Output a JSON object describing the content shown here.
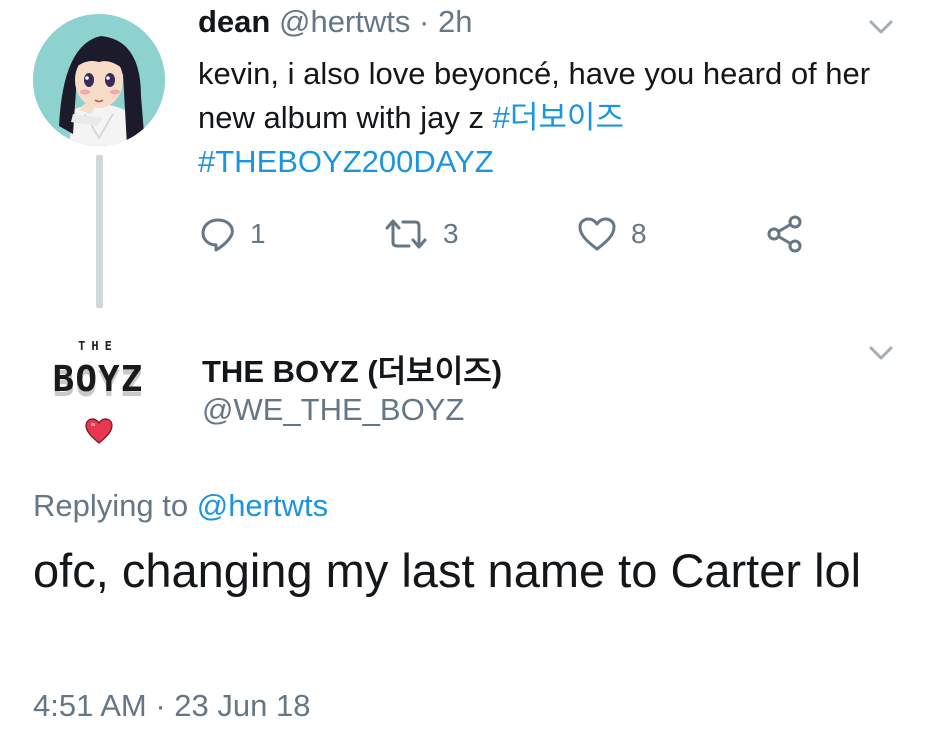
{
  "parent_tweet": {
    "name": "dean",
    "handle": "@hertwts",
    "separator": "·",
    "time": "2h",
    "text_plain": "kevin, i also love beyoncé, have you heard of her new album with jay z",
    "hashtags": [
      "#더보이즈",
      "#THEBOYZ200DAYZ"
    ],
    "reply_count": "1",
    "retweet_count": "3",
    "like_count": "8",
    "avatar_icon": "anime-girl-avatar"
  },
  "main_tweet": {
    "name": "THE BOYZ (더보이즈)",
    "handle": "@WE_THE_BOYZ",
    "logo": {
      "top": "THE",
      "word": "BOYZ"
    },
    "replying_prefix": "Replying to",
    "replying_to": "@hertwts",
    "text": "ofc, changing my last name to Carter lol",
    "timestamp": "4:51 AM · 23 Jun 18"
  },
  "colors": {
    "link": "#1b95e0",
    "secondary_text": "#657786",
    "primary_text": "#14171a",
    "thread_line": "#cfd8dc",
    "heart": "#e8374f"
  },
  "icons": [
    "reply-icon",
    "retweet-icon",
    "like-icon",
    "share-icon",
    "chevron-down-icon"
  ]
}
